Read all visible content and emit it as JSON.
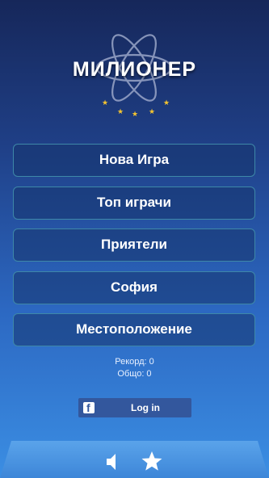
{
  "app": {
    "logo_text": "МИЛИОНЕР"
  },
  "menu": {
    "items": [
      {
        "label": "Нова Игра"
      },
      {
        "label": "Топ играчи"
      },
      {
        "label": "Приятели"
      },
      {
        "label": "София"
      },
      {
        "label": "Местоположение"
      }
    ]
  },
  "stats": {
    "record": "Рекорд: 0",
    "total": "Общо: 0"
  },
  "facebook": {
    "login_label": "Log in",
    "icon": "facebook-icon",
    "color": "#33579d"
  },
  "bottom_bar": {
    "icons": [
      "sound-icon",
      "star-icon"
    ]
  },
  "colors": {
    "background_top": "#16275a",
    "background_bottom": "#3b8ee3",
    "button_border": "#3e88a8",
    "star_accent": "#f4c430"
  }
}
